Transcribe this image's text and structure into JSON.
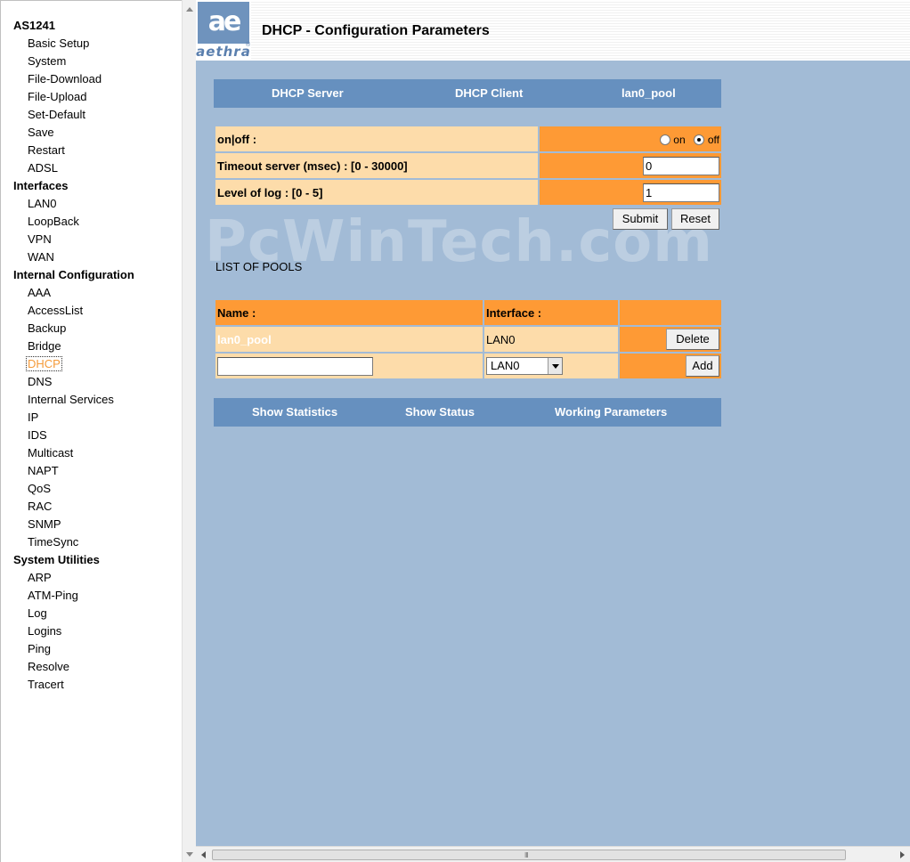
{
  "sidebar": {
    "sections": [
      {
        "header": "AS1241",
        "items": [
          "Basic Setup",
          "System",
          "File-Download",
          "File-Upload",
          "Set-Default",
          "Save",
          "Restart",
          "ADSL"
        ]
      },
      {
        "header": "Interfaces",
        "items": [
          "LAN0",
          "LoopBack",
          "VPN",
          "WAN"
        ]
      },
      {
        "header": "Internal Configuration",
        "items": [
          "AAA",
          "AccessList",
          "Backup",
          "Bridge",
          "DHCP",
          "DNS",
          "Internal Services",
          "IP",
          "IDS",
          "Multicast",
          "NAPT",
          "QoS",
          "RAC",
          "SNMP",
          "TimeSync"
        ]
      },
      {
        "header": "System Utilities",
        "items": [
          "ARP",
          "ATM-Ping",
          "Log",
          "Logins",
          "Ping",
          "Resolve",
          "Tracert"
        ]
      }
    ],
    "active_item": "DHCP"
  },
  "header": {
    "logo_mark": "ae",
    "logo_text": "aethra",
    "logo_reg": "®",
    "title": "DHCP - Configuration Parameters"
  },
  "top_nav": {
    "dhcp_server": "DHCP Server",
    "dhcp_client": "DHCP Client",
    "pool": "lan0_pool"
  },
  "form": {
    "onoff_label": "on|off :",
    "on_label": "on",
    "off_label": "off",
    "onoff_value": "off",
    "timeout_label": "Timeout server (msec) : [0 - 30000]",
    "timeout_value": "0",
    "log_label": "Level of log : [0 - 5]",
    "log_value": "1",
    "submit_label": "Submit",
    "reset_label": "Reset"
  },
  "pools": {
    "title": "LIST OF POOLS",
    "col_name": "Name :",
    "col_interface": "Interface :",
    "rows": [
      {
        "name": "lan0_pool",
        "interface": "LAN0",
        "action": "Delete"
      }
    ],
    "new_row": {
      "name_value": "",
      "interface_selected": "LAN0",
      "action": "Add"
    }
  },
  "bottom_nav": {
    "stats": "Show Statistics",
    "status": "Show Status",
    "working": "Working Parameters"
  },
  "watermark": "PcWinTech.com",
  "scrollbar_grip": "III",
  "colors": {
    "page_bg": "#a2bbd6",
    "nav_bg": "#6690bf",
    "label_bg": "#fddcaa",
    "value_bg": "#fe9a35",
    "active_link": "#f59a38"
  }
}
